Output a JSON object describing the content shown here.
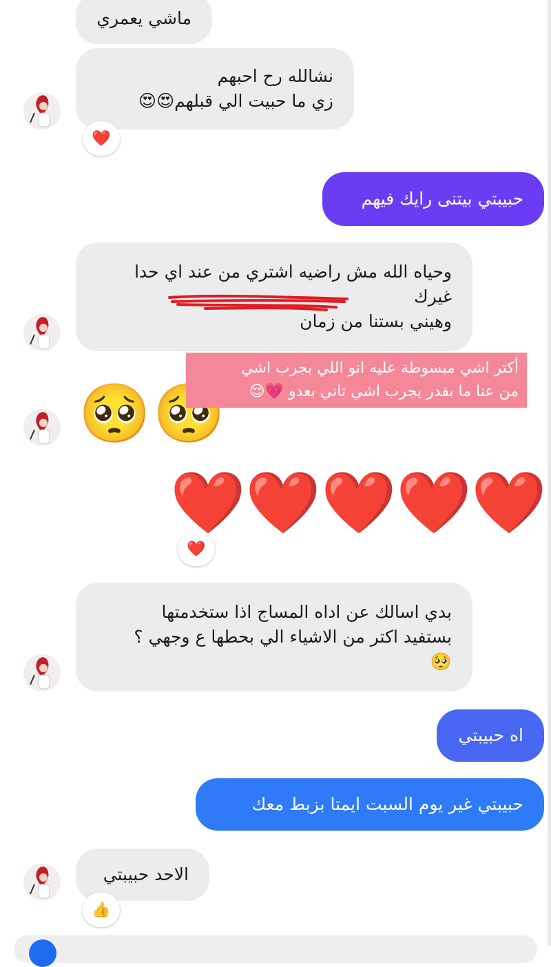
{
  "messages": [
    {
      "id": "m1",
      "from": "contact",
      "text": "ماشي يعمري"
    },
    {
      "id": "m2",
      "from": "contact",
      "lines": [
        "نشالله رح احبهم",
        "زي ما حبيت الي قبلهم😍😍"
      ],
      "reaction": "❤️"
    },
    {
      "id": "m3",
      "from": "me",
      "text": "حبيبتي بيتنى رايك فيهم"
    },
    {
      "id": "m4",
      "from": "contact",
      "lines": [
        "وحياه الله مش راضيه اشتري من عند اي حدا",
        "غيرك",
        "وهيني بستنا من زمان"
      ]
    },
    {
      "id": "m5",
      "from": "contact",
      "emojis": [
        "🥺",
        "🥺"
      ]
    },
    {
      "id": "m6",
      "from": "contact",
      "hearts": [
        "❤️",
        "❤️",
        "❤️",
        "❤️",
        "❤️"
      ],
      "reaction": "❤️"
    },
    {
      "id": "m7",
      "from": "contact",
      "lines": [
        "بدي اسالك عن اداه المساج  اذا ستخدمتها",
        "بستفيد اكتر من الاشياء الي بحطها ع وجهي ؟",
        "🥺"
      ]
    },
    {
      "id": "m8",
      "from": "me",
      "text": "اه حبيبتي"
    },
    {
      "id": "m9",
      "from": "me",
      "text": "حبيبتي غير يوم  السبت ايمتا بزبط معك"
    },
    {
      "id": "m10",
      "from": "contact",
      "text": "الاحد حبيبتي",
      "reaction": "👍"
    }
  ],
  "overlay_caption": {
    "lines": [
      "أكتر اشي مبسوطة عليه انو اللي بجرب اشي",
      "من عنا ما بقدر يجرب اشي تاني بعدو 💗😌"
    ]
  },
  "contact_avatar_icon": "contact-avatar",
  "colors": {
    "incoming_bubble": "#ececef",
    "outgoing_purple": "#6a3df5",
    "outgoing_indigo": "#4867f3",
    "outgoing_blue": "#2f7af6",
    "caption_bg": "#f48898",
    "heart_red": "#e3101b"
  }
}
